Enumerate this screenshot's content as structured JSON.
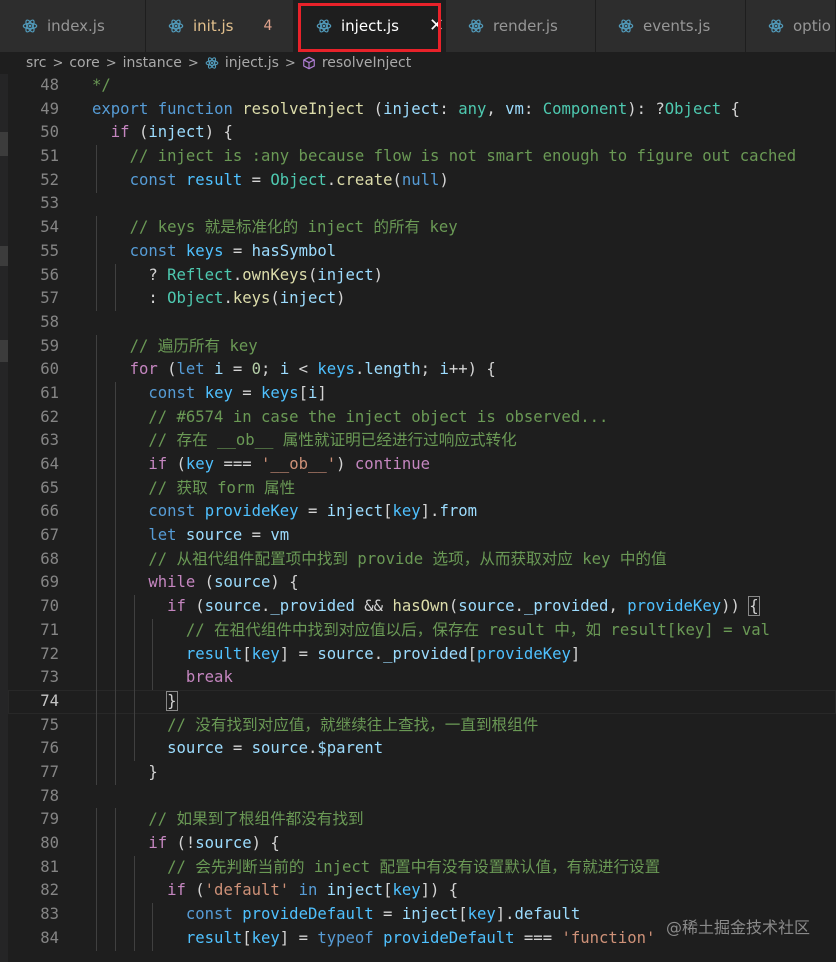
{
  "tabs": [
    {
      "label": "index.js",
      "icon": "react-atom-icon",
      "active": false
    },
    {
      "label": "init.js",
      "icon": "react-atom-icon",
      "active": false,
      "badge": "4"
    },
    {
      "label": "inject.js",
      "icon": "react-atom-icon",
      "active": true,
      "close": "✕"
    },
    {
      "label": "render.js",
      "icon": "react-atom-icon",
      "active": false
    },
    {
      "label": "events.js",
      "icon": "react-atom-icon",
      "active": false
    },
    {
      "label": "optio",
      "icon": "react-atom-icon",
      "active": false
    }
  ],
  "breadcrumb": {
    "items": [
      "src",
      "core",
      "instance",
      "inject.js",
      "resolveInject"
    ],
    "separator": ">"
  },
  "editor": {
    "current_line": 74,
    "lines": [
      {
        "n": "48",
        "t": [
          [
            "c",
            "*/"
          ]
        ]
      },
      {
        "n": "49",
        "t": [
          [
            "k",
            "export"
          ],
          [
            "p",
            " "
          ],
          [
            "k",
            "function"
          ],
          [
            "p",
            " "
          ],
          [
            "fn",
            "resolveInject"
          ],
          [
            "p",
            " ("
          ],
          [
            "v",
            "inject"
          ],
          [
            "p",
            ": "
          ],
          [
            "ty",
            "any"
          ],
          [
            "p",
            ", "
          ],
          [
            "v",
            "vm"
          ],
          [
            "p",
            ": "
          ],
          [
            "ty",
            "Component"
          ],
          [
            "p",
            "): ?"
          ],
          [
            "ty",
            "Object"
          ],
          [
            "p",
            " {"
          ]
        ]
      },
      {
        "n": "50",
        "t": [
          [
            "p",
            "  "
          ],
          [
            "kc",
            "if"
          ],
          [
            "p",
            " ("
          ],
          [
            "v",
            "inject"
          ],
          [
            "p",
            ") {"
          ]
        ]
      },
      {
        "n": "51",
        "t": [
          [
            "p",
            "    "
          ],
          [
            "c",
            "// inject is :any because flow is not smart enough to figure out cached"
          ]
        ]
      },
      {
        "n": "52",
        "t": [
          [
            "p",
            "    "
          ],
          [
            "k",
            "const"
          ],
          [
            "p",
            " "
          ],
          [
            "cst",
            "result"
          ],
          [
            "p",
            " = "
          ],
          [
            "ty",
            "Object"
          ],
          [
            "p",
            "."
          ],
          [
            "fn",
            "create"
          ],
          [
            "p",
            "("
          ],
          [
            "k",
            "null"
          ],
          [
            "p",
            ")"
          ]
        ]
      },
      {
        "n": "53",
        "t": []
      },
      {
        "n": "54",
        "t": [
          [
            "p",
            "    "
          ],
          [
            "c",
            "// keys 就是标准化的 inject 的所有 key"
          ]
        ]
      },
      {
        "n": "55",
        "t": [
          [
            "p",
            "    "
          ],
          [
            "k",
            "const"
          ],
          [
            "p",
            " "
          ],
          [
            "cst",
            "keys"
          ],
          [
            "p",
            " = "
          ],
          [
            "v",
            "hasSymbol"
          ]
        ]
      },
      {
        "n": "56",
        "t": [
          [
            "p",
            "      ? "
          ],
          [
            "ty",
            "Reflect"
          ],
          [
            "p",
            "."
          ],
          [
            "fn",
            "ownKeys"
          ],
          [
            "p",
            "("
          ],
          [
            "v",
            "inject"
          ],
          [
            "p",
            ")"
          ]
        ]
      },
      {
        "n": "57",
        "t": [
          [
            "p",
            "      : "
          ],
          [
            "ty",
            "Object"
          ],
          [
            "p",
            "."
          ],
          [
            "fn",
            "keys"
          ],
          [
            "p",
            "("
          ],
          [
            "v",
            "inject"
          ],
          [
            "p",
            ")"
          ]
        ]
      },
      {
        "n": "58",
        "t": []
      },
      {
        "n": "59",
        "t": [
          [
            "p",
            "    "
          ],
          [
            "c",
            "// 遍历所有 key"
          ]
        ]
      },
      {
        "n": "60",
        "t": [
          [
            "p",
            "    "
          ],
          [
            "kc",
            "for"
          ],
          [
            "p",
            " ("
          ],
          [
            "k",
            "let"
          ],
          [
            "p",
            " "
          ],
          [
            "v",
            "i"
          ],
          [
            "p",
            " = "
          ],
          [
            "n",
            "0"
          ],
          [
            "p",
            "; "
          ],
          [
            "v",
            "i"
          ],
          [
            "p",
            " < "
          ],
          [
            "cst",
            "keys"
          ],
          [
            "p",
            "."
          ],
          [
            "v",
            "length"
          ],
          [
            "p",
            "; "
          ],
          [
            "v",
            "i"
          ],
          [
            "p",
            "++) {"
          ]
        ]
      },
      {
        "n": "61",
        "t": [
          [
            "p",
            "      "
          ],
          [
            "k",
            "const"
          ],
          [
            "p",
            " "
          ],
          [
            "cst",
            "key"
          ],
          [
            "p",
            " = "
          ],
          [
            "cst",
            "keys"
          ],
          [
            "p",
            "["
          ],
          [
            "v",
            "i"
          ],
          [
            "p",
            "]"
          ]
        ]
      },
      {
        "n": "62",
        "t": [
          [
            "p",
            "      "
          ],
          [
            "c",
            "// #6574 in case the inject object is observed..."
          ]
        ]
      },
      {
        "n": "63",
        "t": [
          [
            "p",
            "      "
          ],
          [
            "c",
            "// 存在 __ob__ 属性就证明已经进行过响应式转化"
          ]
        ]
      },
      {
        "n": "64",
        "t": [
          [
            "p",
            "      "
          ],
          [
            "kc",
            "if"
          ],
          [
            "p",
            " ("
          ],
          [
            "cst",
            "key"
          ],
          [
            "p",
            " === "
          ],
          [
            "s",
            "'__ob__'"
          ],
          [
            "p",
            ") "
          ],
          [
            "kc",
            "continue"
          ]
        ]
      },
      {
        "n": "65",
        "t": [
          [
            "p",
            "      "
          ],
          [
            "c",
            "// 获取 form 属性"
          ]
        ]
      },
      {
        "n": "66",
        "t": [
          [
            "p",
            "      "
          ],
          [
            "k",
            "const"
          ],
          [
            "p",
            " "
          ],
          [
            "cst",
            "provideKey"
          ],
          [
            "p",
            " = "
          ],
          [
            "v",
            "inject"
          ],
          [
            "p",
            "["
          ],
          [
            "cst",
            "key"
          ],
          [
            "p",
            "]."
          ],
          [
            "v",
            "from"
          ]
        ]
      },
      {
        "n": "67",
        "t": [
          [
            "p",
            "      "
          ],
          [
            "k",
            "let"
          ],
          [
            "p",
            " "
          ],
          [
            "v",
            "source"
          ],
          [
            "p",
            " = "
          ],
          [
            "v",
            "vm"
          ]
        ]
      },
      {
        "n": "68",
        "t": [
          [
            "p",
            "      "
          ],
          [
            "c",
            "// 从祖代组件配置项中找到 provide 选项，从而获取对应 key 中的值"
          ]
        ]
      },
      {
        "n": "69",
        "t": [
          [
            "p",
            "      "
          ],
          [
            "kc",
            "while"
          ],
          [
            "p",
            " ("
          ],
          [
            "v",
            "source"
          ],
          [
            "p",
            ") {"
          ]
        ]
      },
      {
        "n": "70",
        "t": [
          [
            "p",
            "        "
          ],
          [
            "kc",
            "if"
          ],
          [
            "p",
            " ("
          ],
          [
            "v",
            "source"
          ],
          [
            "p",
            "."
          ],
          [
            "v",
            "_provided"
          ],
          [
            "p",
            " && "
          ],
          [
            "fn",
            "hasOwn"
          ],
          [
            "p",
            "("
          ],
          [
            "v",
            "source"
          ],
          [
            "p",
            "."
          ],
          [
            "v",
            "_provided"
          ],
          [
            "p",
            ", "
          ],
          [
            "cst",
            "provideKey"
          ],
          [
            "p",
            ")) "
          ],
          [
            "bm",
            "{"
          ]
        ]
      },
      {
        "n": "71",
        "t": [
          [
            "p",
            "          "
          ],
          [
            "c",
            "// 在祖代组件中找到对应值以后，保存在 result 中，如 result[key] = val"
          ]
        ]
      },
      {
        "n": "72",
        "t": [
          [
            "p",
            "          "
          ],
          [
            "cst",
            "result"
          ],
          [
            "p",
            "["
          ],
          [
            "cst",
            "key"
          ],
          [
            "p",
            "] = "
          ],
          [
            "v",
            "source"
          ],
          [
            "p",
            "."
          ],
          [
            "v",
            "_provided"
          ],
          [
            "p",
            "["
          ],
          [
            "cst",
            "provideKey"
          ],
          [
            "p",
            "]"
          ]
        ]
      },
      {
        "n": "73",
        "t": [
          [
            "p",
            "          "
          ],
          [
            "kc",
            "break"
          ]
        ]
      },
      {
        "n": "74",
        "t": [
          [
            "p",
            "        "
          ],
          [
            "bm",
            "}"
          ]
        ]
      },
      {
        "n": "75",
        "t": [
          [
            "p",
            "        "
          ],
          [
            "c",
            "// 没有找到对应值，就继续往上查找，一直到根组件"
          ]
        ]
      },
      {
        "n": "76",
        "t": [
          [
            "p",
            "        "
          ],
          [
            "v",
            "source"
          ],
          [
            "p",
            " = "
          ],
          [
            "v",
            "source"
          ],
          [
            "p",
            "."
          ],
          [
            "v",
            "$parent"
          ]
        ]
      },
      {
        "n": "77",
        "t": [
          [
            "p",
            "      }"
          ]
        ]
      },
      {
        "n": "78",
        "t": []
      },
      {
        "n": "79",
        "t": [
          [
            "p",
            "      "
          ],
          [
            "c",
            "// 如果到了根组件都没有找到"
          ]
        ]
      },
      {
        "n": "80",
        "t": [
          [
            "p",
            "      "
          ],
          [
            "kc",
            "if"
          ],
          [
            "p",
            " (!"
          ],
          [
            "v",
            "source"
          ],
          [
            "p",
            ") {"
          ]
        ]
      },
      {
        "n": "81",
        "t": [
          [
            "p",
            "        "
          ],
          [
            "c",
            "// 会先判断当前的 inject 配置中有没有设置默认值，有就进行设置"
          ]
        ]
      },
      {
        "n": "82",
        "t": [
          [
            "p",
            "        "
          ],
          [
            "kc",
            "if"
          ],
          [
            "p",
            " ("
          ],
          [
            "s",
            "'default'"
          ],
          [
            "p",
            " "
          ],
          [
            "k",
            "in"
          ],
          [
            "p",
            " "
          ],
          [
            "v",
            "inject"
          ],
          [
            "p",
            "["
          ],
          [
            "cst",
            "key"
          ],
          [
            "p",
            "]) {"
          ]
        ]
      },
      {
        "n": "83",
        "t": [
          [
            "p",
            "          "
          ],
          [
            "k",
            "const"
          ],
          [
            "p",
            " "
          ],
          [
            "cst",
            "provideDefault"
          ],
          [
            "p",
            " = "
          ],
          [
            "v",
            "inject"
          ],
          [
            "p",
            "["
          ],
          [
            "cst",
            "key"
          ],
          [
            "p",
            "]."
          ],
          [
            "v",
            "default"
          ]
        ]
      },
      {
        "n": "84",
        "t": [
          [
            "p",
            "          "
          ],
          [
            "cst",
            "result"
          ],
          [
            "p",
            "["
          ],
          [
            "cst",
            "key"
          ],
          [
            "p",
            "] = "
          ],
          [
            "k",
            "typeof"
          ],
          [
            "p",
            " "
          ],
          [
            "cst",
            "provideDefault"
          ],
          [
            "p",
            " === "
          ],
          [
            "s",
            "'function'"
          ]
        ]
      }
    ]
  },
  "watermark": "@稀土掘金技术社区"
}
